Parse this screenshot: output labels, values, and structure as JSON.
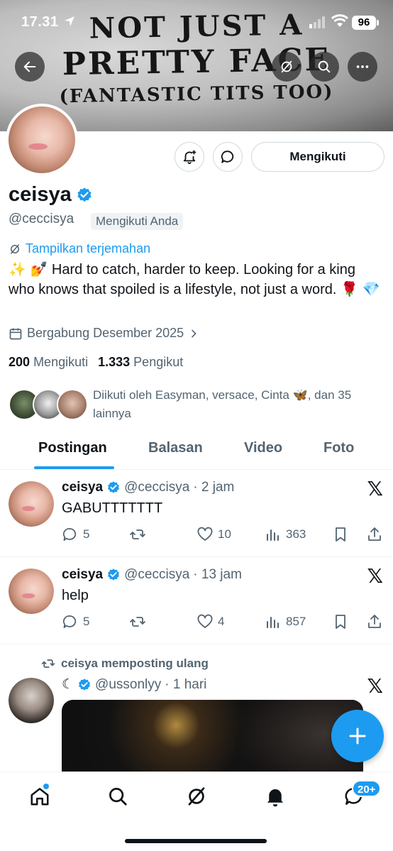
{
  "status_bar": {
    "time": "17.31",
    "battery": "96"
  },
  "banner": {
    "line1": "NOT JUST A",
    "line2": "PRETTY FACE",
    "line3": "(FANTASTIC TITS TOO)"
  },
  "profile": {
    "name": "ceisya",
    "handle": "@ceccisya",
    "follows_you": "Mengikuti Anda",
    "follow_button": "Mengikuti",
    "translate": "Tampilkan terjemahan",
    "bio": "✨ 💅 Hard to catch, harder to keep. Looking for a king who knows that spoiled is a lifestyle, not just a word. 🌹 💎",
    "joined": "Bergabung Desember 2025",
    "following_count": "200",
    "following_label": "Mengikuti",
    "followers_count": "1.333",
    "followers_label": "Pengikut",
    "followed_by": "Diikuti oleh Easyman, versace, Cinta 🦋, dan 35 lainnya"
  },
  "tabs": [
    "Postingan",
    "Balasan",
    "Video",
    "Foto"
  ],
  "posts": [
    {
      "name": "ceisya",
      "handle": "@ceccisya",
      "time": "· 2 jam",
      "text": "GABUTTTTTTT",
      "replies": "5",
      "reposts": "",
      "likes": "10",
      "views": "363"
    },
    {
      "name": "ceisya",
      "handle": "@ceccisya",
      "time": "· 13 jam",
      "text": "help",
      "replies": "5",
      "reposts": "",
      "likes": "4",
      "views": "857"
    },
    {
      "repost_label": "ceisya memposting ulang",
      "name": "☾",
      "handle": "@ussonlyy",
      "time": "· 1 hari"
    }
  ],
  "nav": {
    "messages_badge": "20+"
  },
  "colors": {
    "accent": "#1d9bf0",
    "text": "#0f1419",
    "muted": "#536471"
  }
}
